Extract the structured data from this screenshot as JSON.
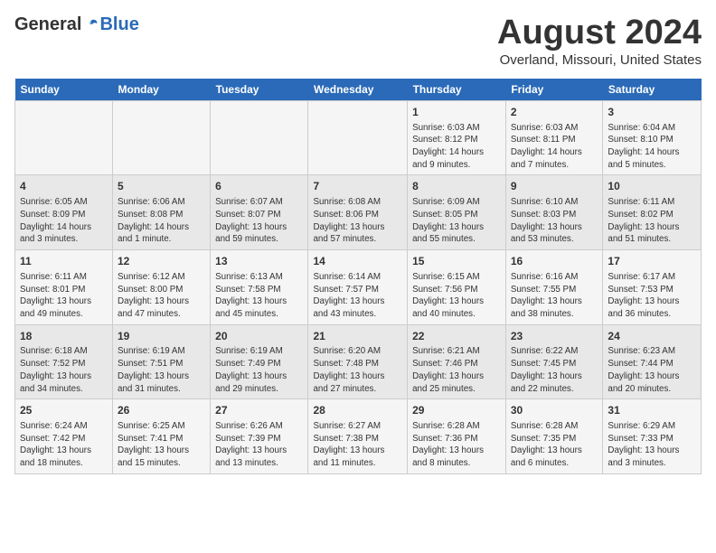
{
  "logo": {
    "general": "General",
    "blue": "Blue"
  },
  "title": "August 2024",
  "subtitle": "Overland, Missouri, United States",
  "days_header": [
    "Sunday",
    "Monday",
    "Tuesday",
    "Wednesday",
    "Thursday",
    "Friday",
    "Saturday"
  ],
  "weeks": [
    [
      {
        "num": "",
        "info": ""
      },
      {
        "num": "",
        "info": ""
      },
      {
        "num": "",
        "info": ""
      },
      {
        "num": "",
        "info": ""
      },
      {
        "num": "1",
        "info": "Sunrise: 6:03 AM\nSunset: 8:12 PM\nDaylight: 14 hours\nand 9 minutes."
      },
      {
        "num": "2",
        "info": "Sunrise: 6:03 AM\nSunset: 8:11 PM\nDaylight: 14 hours\nand 7 minutes."
      },
      {
        "num": "3",
        "info": "Sunrise: 6:04 AM\nSunset: 8:10 PM\nDaylight: 14 hours\nand 5 minutes."
      }
    ],
    [
      {
        "num": "4",
        "info": "Sunrise: 6:05 AM\nSunset: 8:09 PM\nDaylight: 14 hours\nand 3 minutes."
      },
      {
        "num": "5",
        "info": "Sunrise: 6:06 AM\nSunset: 8:08 PM\nDaylight: 14 hours\nand 1 minute."
      },
      {
        "num": "6",
        "info": "Sunrise: 6:07 AM\nSunset: 8:07 PM\nDaylight: 13 hours\nand 59 minutes."
      },
      {
        "num": "7",
        "info": "Sunrise: 6:08 AM\nSunset: 8:06 PM\nDaylight: 13 hours\nand 57 minutes."
      },
      {
        "num": "8",
        "info": "Sunrise: 6:09 AM\nSunset: 8:05 PM\nDaylight: 13 hours\nand 55 minutes."
      },
      {
        "num": "9",
        "info": "Sunrise: 6:10 AM\nSunset: 8:03 PM\nDaylight: 13 hours\nand 53 minutes."
      },
      {
        "num": "10",
        "info": "Sunrise: 6:11 AM\nSunset: 8:02 PM\nDaylight: 13 hours\nand 51 minutes."
      }
    ],
    [
      {
        "num": "11",
        "info": "Sunrise: 6:11 AM\nSunset: 8:01 PM\nDaylight: 13 hours\nand 49 minutes."
      },
      {
        "num": "12",
        "info": "Sunrise: 6:12 AM\nSunset: 8:00 PM\nDaylight: 13 hours\nand 47 minutes."
      },
      {
        "num": "13",
        "info": "Sunrise: 6:13 AM\nSunset: 7:58 PM\nDaylight: 13 hours\nand 45 minutes."
      },
      {
        "num": "14",
        "info": "Sunrise: 6:14 AM\nSunset: 7:57 PM\nDaylight: 13 hours\nand 43 minutes."
      },
      {
        "num": "15",
        "info": "Sunrise: 6:15 AM\nSunset: 7:56 PM\nDaylight: 13 hours\nand 40 minutes."
      },
      {
        "num": "16",
        "info": "Sunrise: 6:16 AM\nSunset: 7:55 PM\nDaylight: 13 hours\nand 38 minutes."
      },
      {
        "num": "17",
        "info": "Sunrise: 6:17 AM\nSunset: 7:53 PM\nDaylight: 13 hours\nand 36 minutes."
      }
    ],
    [
      {
        "num": "18",
        "info": "Sunrise: 6:18 AM\nSunset: 7:52 PM\nDaylight: 13 hours\nand 34 minutes."
      },
      {
        "num": "19",
        "info": "Sunrise: 6:19 AM\nSunset: 7:51 PM\nDaylight: 13 hours\nand 31 minutes."
      },
      {
        "num": "20",
        "info": "Sunrise: 6:19 AM\nSunset: 7:49 PM\nDaylight: 13 hours\nand 29 minutes."
      },
      {
        "num": "21",
        "info": "Sunrise: 6:20 AM\nSunset: 7:48 PM\nDaylight: 13 hours\nand 27 minutes."
      },
      {
        "num": "22",
        "info": "Sunrise: 6:21 AM\nSunset: 7:46 PM\nDaylight: 13 hours\nand 25 minutes."
      },
      {
        "num": "23",
        "info": "Sunrise: 6:22 AM\nSunset: 7:45 PM\nDaylight: 13 hours\nand 22 minutes."
      },
      {
        "num": "24",
        "info": "Sunrise: 6:23 AM\nSunset: 7:44 PM\nDaylight: 13 hours\nand 20 minutes."
      }
    ],
    [
      {
        "num": "25",
        "info": "Sunrise: 6:24 AM\nSunset: 7:42 PM\nDaylight: 13 hours\nand 18 minutes."
      },
      {
        "num": "26",
        "info": "Sunrise: 6:25 AM\nSunset: 7:41 PM\nDaylight: 13 hours\nand 15 minutes."
      },
      {
        "num": "27",
        "info": "Sunrise: 6:26 AM\nSunset: 7:39 PM\nDaylight: 13 hours\nand 13 minutes."
      },
      {
        "num": "28",
        "info": "Sunrise: 6:27 AM\nSunset: 7:38 PM\nDaylight: 13 hours\nand 11 minutes."
      },
      {
        "num": "29",
        "info": "Sunrise: 6:28 AM\nSunset: 7:36 PM\nDaylight: 13 hours\nand 8 minutes."
      },
      {
        "num": "30",
        "info": "Sunrise: 6:28 AM\nSunset: 7:35 PM\nDaylight: 13 hours\nand 6 minutes."
      },
      {
        "num": "31",
        "info": "Sunrise: 6:29 AM\nSunset: 7:33 PM\nDaylight: 13 hours\nand 3 minutes."
      }
    ]
  ]
}
